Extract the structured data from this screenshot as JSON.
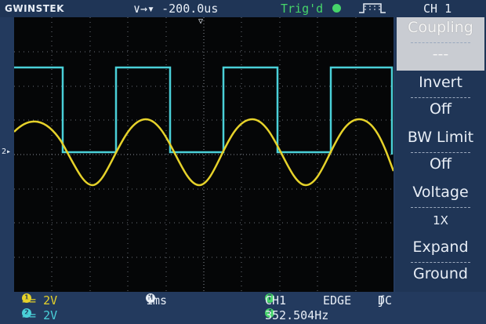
{
  "header": {
    "brand": "GWINSTEK",
    "timebase": "∨→▾ -200.0us",
    "trigger_state": "Trig'd",
    "channel_title": "CH 1"
  },
  "softmenu": [
    {
      "label": "Coupling",
      "value": "---"
    },
    {
      "label": "Invert",
      "value": "Off"
    },
    {
      "label": "BW Limit",
      "value": "Off"
    },
    {
      "label": "Voltage",
      "value": "1X"
    },
    {
      "label": "Expand",
      "value": "Ground"
    }
  ],
  "status": {
    "ch1_scale": "== 2V",
    "ch2_scale": "== 2V",
    "time_scale": "1ms",
    "trigger_source": "CH1",
    "trigger_type": "EDGE",
    "trigger_coupling": "DC",
    "frequency": "352.504Hz"
  },
  "colors": {
    "ch1": "#e6d22a",
    "ch2": "#4ad0d8",
    "trigger": "#46d46a"
  },
  "icons": {
    "timebase": "delay-arrow-icon",
    "trigger": "trigger-dot-icon",
    "edge": "rising-edge-icon",
    "channel_badge_1": "channel-1-badge-icon",
    "channel_badge_2": "channel-2-badge-icon",
    "time_badge": "horizontal-m-badge-icon",
    "trigger_badge": "trigger-t-badge-icon",
    "freq_badge": "frequency-badge-icon"
  }
}
